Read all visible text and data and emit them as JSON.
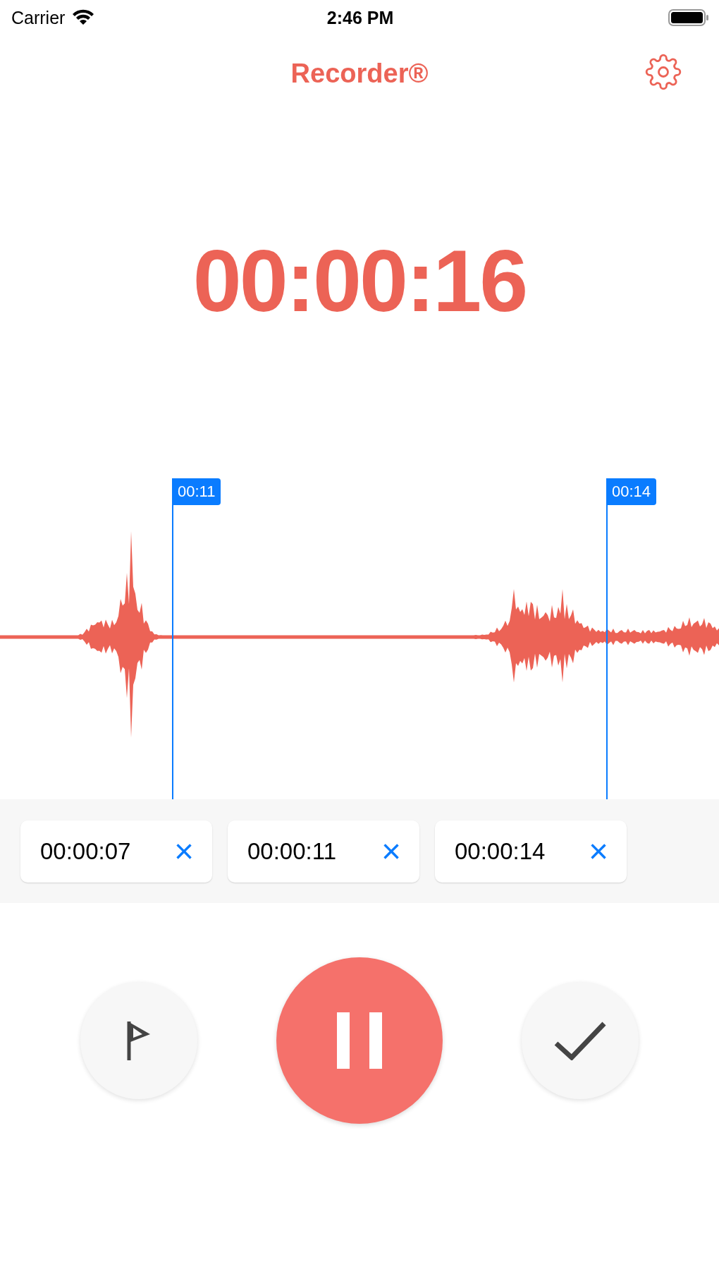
{
  "status_bar": {
    "carrier": "Carrier",
    "time": "2:46 PM"
  },
  "nav": {
    "title": "Recorder®"
  },
  "timer": "00:00:16",
  "markers": [
    {
      "label": "00:11"
    },
    {
      "label": "00:14"
    }
  ],
  "bookmarks": [
    {
      "time": "00:00:07",
      "remove": "×"
    },
    {
      "time": "00:00:11",
      "remove": "×"
    },
    {
      "time": "00:00:14",
      "remove": "×"
    }
  ]
}
